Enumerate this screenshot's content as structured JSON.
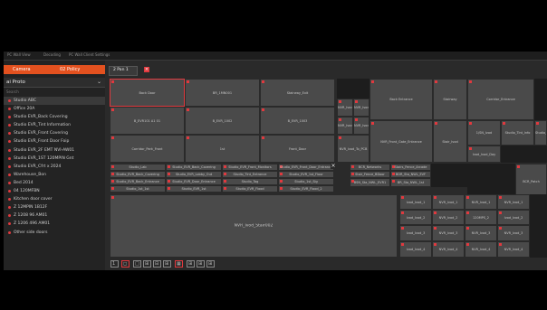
{
  "topbar": {
    "items": [
      "PC Wall View",
      "Decoding",
      "PC Wall Client Settings"
    ]
  },
  "sidebar": {
    "section_left": "Camera",
    "section_right": "02 Policy",
    "selected_group": "ai Proto",
    "filter_label": "Search",
    "items": [
      "Studio ABC",
      "Office 20A",
      "Studio EVR_Back Covering",
      "Studio EVR_Tint Information",
      "Studio EVR_Front Covering",
      "Studio EVR_Front Door Foip",
      "Studio EVR_2F EMT NVI-AW01",
      "Studio EVR_1ST 120MPIN Gnt",
      "Studio EVR_Cfrt x 2024",
      "Warehouse_Bon",
      "Bed 2014",
      "04 120MFBN",
      "Kitchen door cover",
      "Z 12MPIN 1B12F",
      "Z 1208 96 AM01",
      "Z 1206 496 AM01",
      "Other side doors"
    ]
  },
  "tab": {
    "label": "2 Pan 1",
    "close": "×"
  },
  "cells": {
    "r1": [
      "Back Door",
      "BR_1MN001",
      "Stairway_Exit"
    ],
    "r2": [
      "B_EVR101 A1 01",
      "B_EVR_1002",
      "B_EVR_1003"
    ],
    "r3": [
      "Corridor_Park_Front",
      "1st",
      "Front_Door"
    ],
    "mid": [
      "NVR_Ivod_Day",
      "NVR_Ivod_20F",
      "Back Entrance",
      "NVR_Ivod_To",
      "NVR_Ivod_Day_Ipt",
      "NVR_Front_Gate_Entrance",
      "NVR_Ivod_To_PCB",
      "Stairway",
      "Stair_Ivod",
      "Studio_Ivod",
      "Ivod_Ivod_Day"
    ],
    "strip": [
      "Studio_Lab",
      "Studio_EVR_Back_Covering",
      "Studio_EVR_Front_Monitors",
      "Studio_EVR_Front_Door_Entrance",
      "Studio_EVR_Back_Covering",
      "Studio_EVR_Lobby_Out",
      "Studio_Tint_Entrance",
      "Studio_EVR_1st_Floor",
      "Studio_EVR_Back_Entrance",
      "Studio_EVR_Door_Entrance",
      "Studio_Tag",
      "Studio_1st_Sig",
      "Studio_1st_1st",
      "Studio_EVR_1st",
      "Studio_EVR_Flood",
      "Studio_EVR_Flood_2",
      "Studio_S_1st",
      "Studio_S_SBS"
    ],
    "right_small": [
      "BCR_Networks",
      "Stairs_Fence_Arcade",
      "Stair_Fence_BDoor",
      "BDR_Sta_NWL_EVF",
      "BSN_Sta_NWL_EVR1",
      "BR_Sta_NWL_1st",
      "BCR_Patch"
    ],
    "big": "NVR_Ivod_Stair002",
    "grid": [
      "Ivod_Ivod_1",
      "NVR_Ivod_1",
      "NVR_Ivod_1",
      "NVR_Ivod_1",
      "Ivod_Ivod_2",
      "NVR_Ivod_2",
      "120MPS_2",
      "Ivod_Ivod_2",
      "Ivod_Ivod_3",
      "NVR_Ivod_3",
      "NVR_Ivod_3",
      "NVR_Ivod_3",
      "Ivod_Ivod_4",
      "NVR_Ivod_4",
      "NVR_Ivod_4",
      "NVR_Ivod_4"
    ],
    "topright": "Corridor_Entrance",
    "midright": [
      "1/SN_Ivod",
      "Studio_Tint_Info"
    ]
  },
  "bottom": {
    "buttons": [
      "1",
      "◻",
      "□",
      "⊞",
      "⊟",
      "⊞",
      "▦",
      "⊞",
      "⊞",
      "⊞"
    ]
  },
  "colors": {
    "accent": "#e3511f",
    "marker": "#e0393e",
    "cell": "#4a4a4a",
    "background": "#2b2b2b"
  }
}
